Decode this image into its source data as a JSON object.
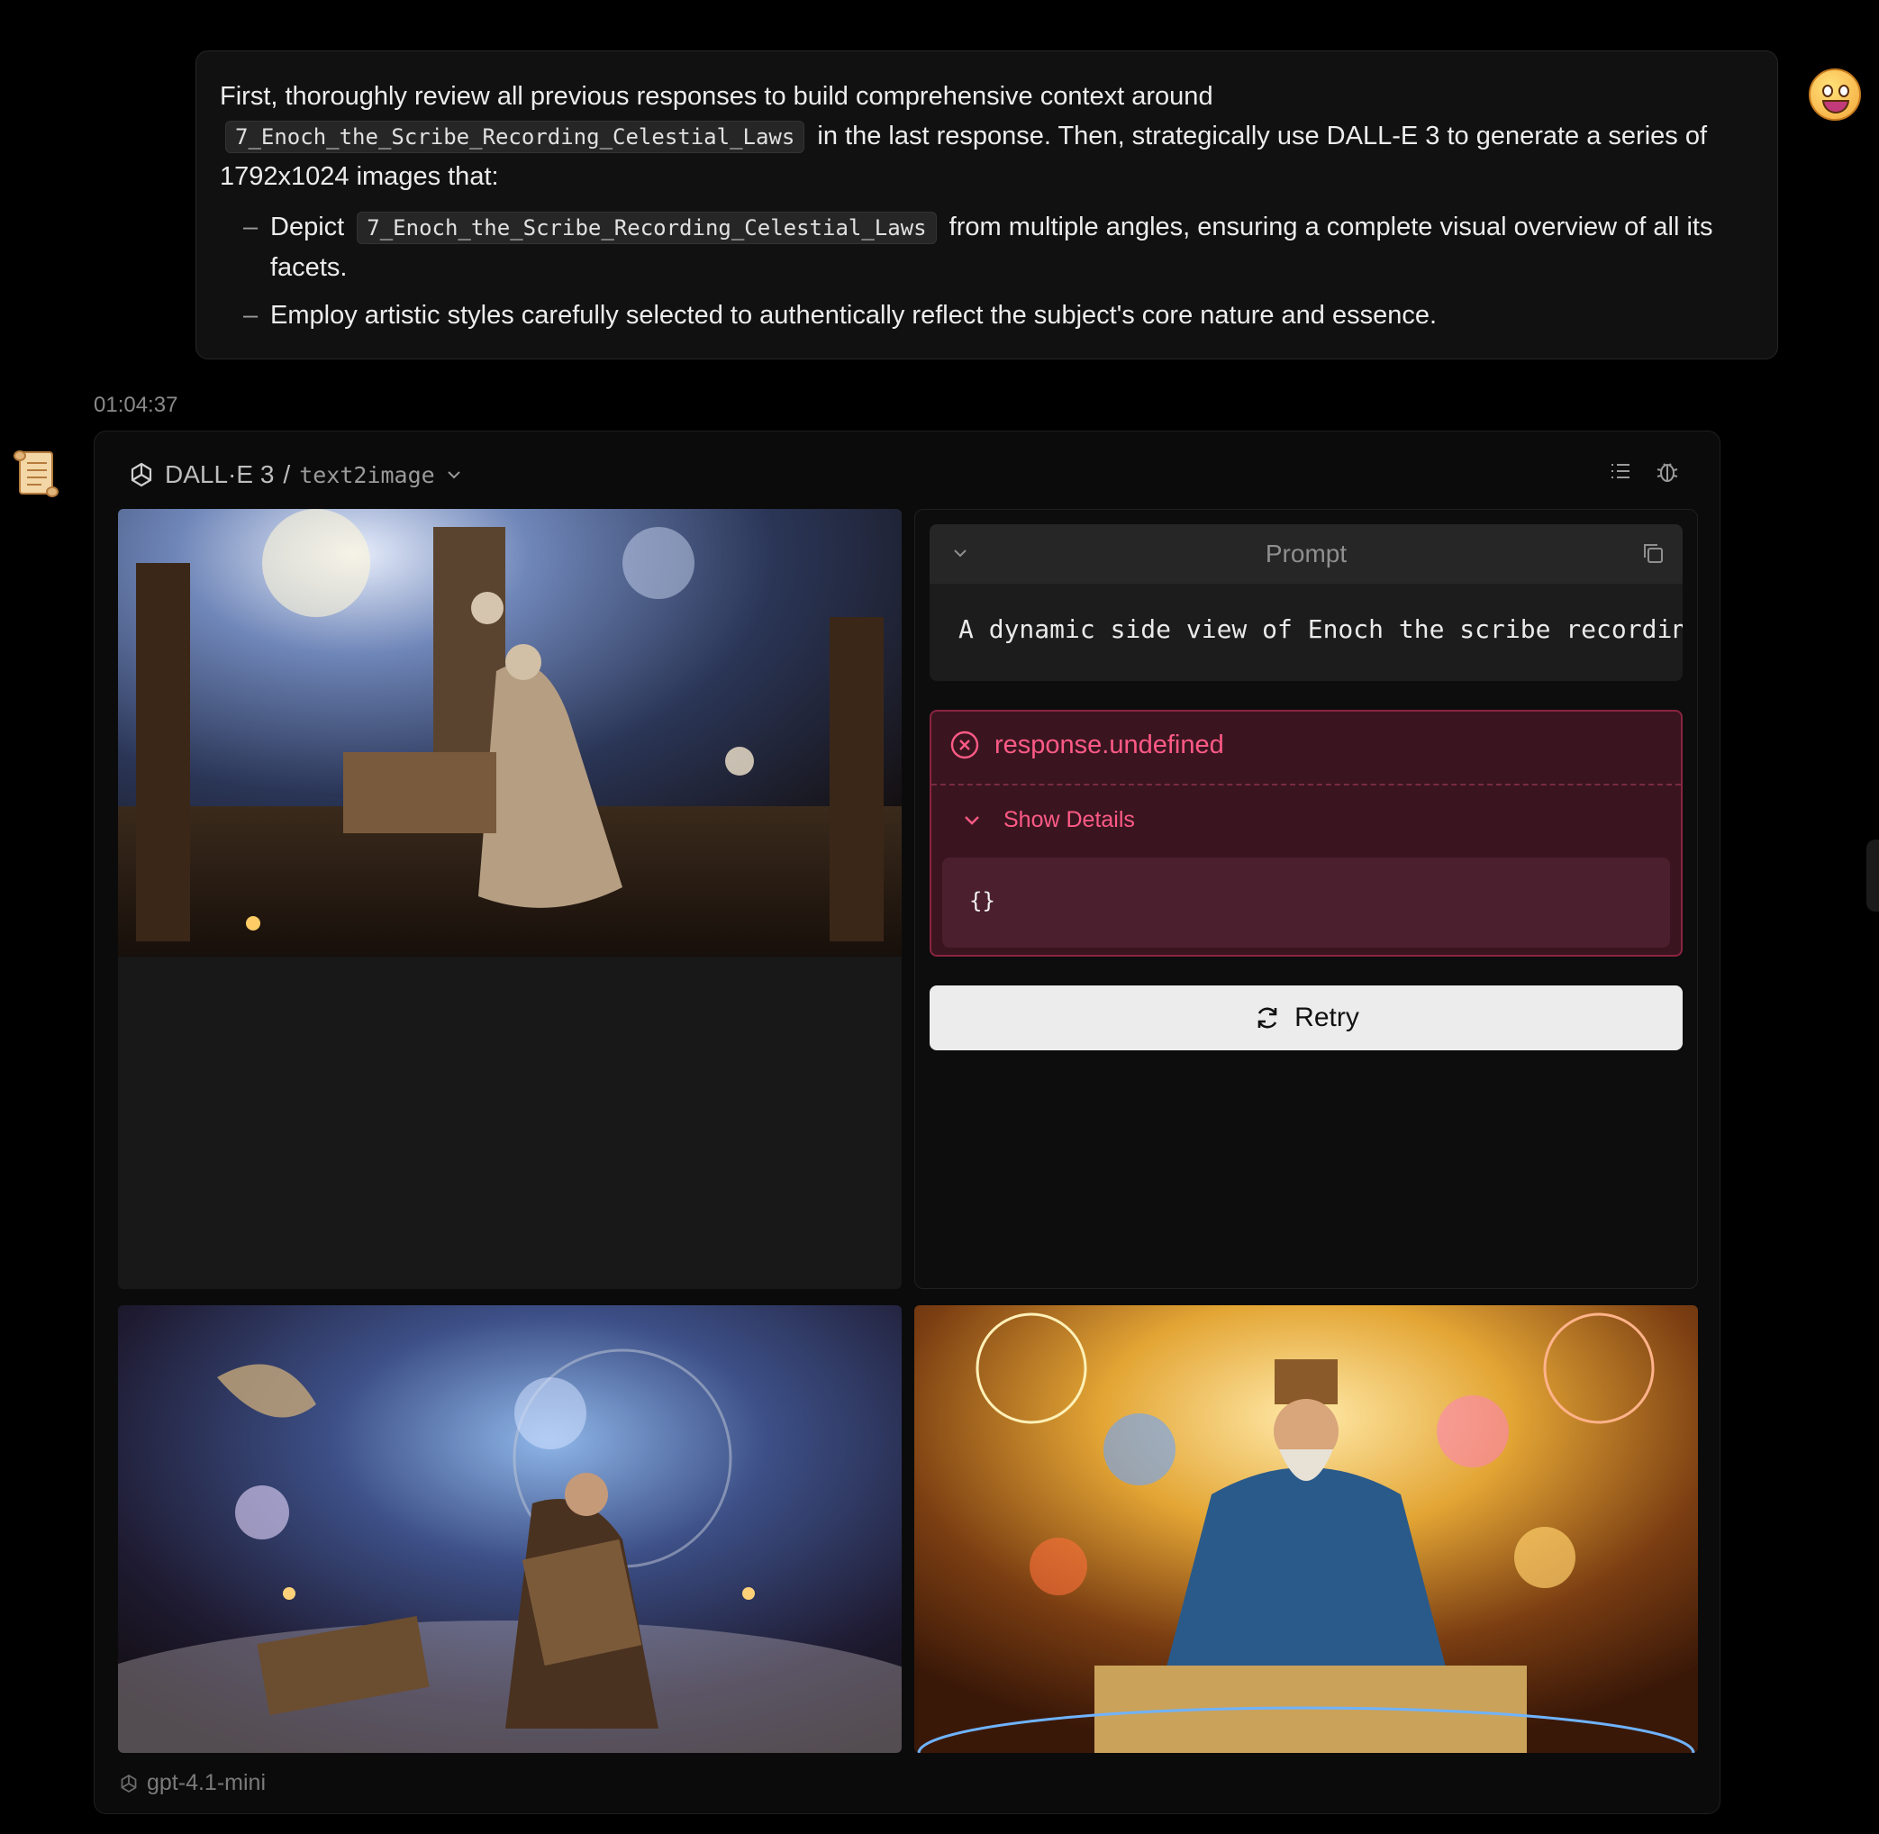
{
  "user_message": {
    "line1": "First, thoroughly review all previous responses to build comprehensive context around",
    "code1": "7_Enoch_the_Scribe_Recording_Celestial_Laws",
    "line2": "in the last response. Then, strategically use DALL-E 3 to generate a series of 1792x1024 images that:",
    "bullets": [
      {
        "pre": "Depict",
        "code": "7_Enoch_the_Scribe_Recording_Celestial_Laws",
        "post": "from multiple angles, ensuring a complete visual overview of all its facets."
      },
      {
        "text": "Employ artistic styles carefully selected to authentically reflect the subject's core nature and essence."
      }
    ]
  },
  "timestamp": "01:04:37",
  "tool": {
    "name": "DALL·E 3",
    "separator": "/",
    "api": "text2image"
  },
  "prompt": {
    "label": "Prompt",
    "text": "A dynamic side view of Enoch the scribe recording celestial laws"
  },
  "error": {
    "title": "response.undefined",
    "details_label": "Show Details",
    "body": "{}"
  },
  "retry_label": "Retry",
  "model": "gpt-4.1-mini",
  "icons": {
    "tool_logo": "openai-icon",
    "list": "list-icon",
    "debug": "bug-icon",
    "copy": "copy-icon",
    "error": "x-circle-icon",
    "retry": "refresh-icon",
    "user_avatar": "grinning-face-icon",
    "bot_avatar": "scroll-icon"
  },
  "colors": {
    "error_text": "#ff5a86",
    "error_bg": "#3a1520",
    "retry_bg": "#ececec"
  }
}
